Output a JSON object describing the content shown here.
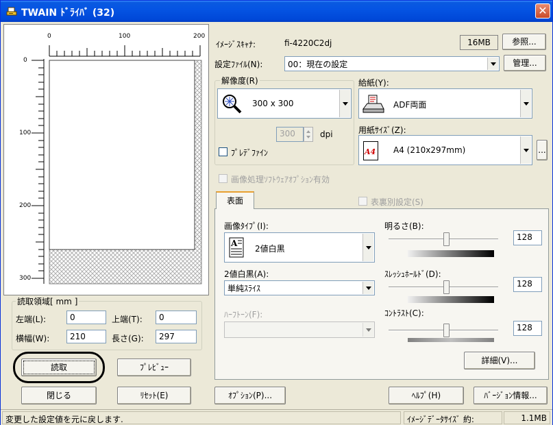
{
  "window": {
    "title": "TWAIN ﾄﾞﾗｲﾊﾞ (32)",
    "close_glyph": "✕"
  },
  "ruler": {
    "top_labels": [
      "0",
      "100",
      "200"
    ],
    "left_labels": [
      "0",
      "100",
      "200",
      "300"
    ]
  },
  "region": {
    "title": "読取領域[ mm ]",
    "left_label": "左端(L):",
    "left_value": "0",
    "top_label": "上端(T):",
    "top_value": "0",
    "width_label": "横幅(W):",
    "width_value": "210",
    "height_label": "長さ(G):",
    "height_value": "297"
  },
  "left_buttons": {
    "scan": "読取",
    "preview": "ﾌﾟﾚﾋﾞｭｰ",
    "close": "閉じる",
    "reset": "ﾘｾｯﾄ(E)"
  },
  "scanner": {
    "label": "ｲﾒｰｼﾞｽｷｬﾅ:",
    "model": "fi-4220C2dj",
    "memory": "16MB",
    "browse_button": "参照..."
  },
  "settings_file": {
    "label": "設定ﾌｧｲﾙ(N):",
    "value": "00：現在の設定",
    "manage_button": "管理..."
  },
  "resolution": {
    "label": "解像度(R)",
    "value": "300 x 300",
    "custom_value": "300",
    "unit": "dpi",
    "predefine_label": "ﾌﾟﾚﾃﾞﾌｧｲﾝ"
  },
  "feed": {
    "label": "給紙(Y):",
    "value": "ADF両面"
  },
  "paper_size": {
    "label": "用紙ｻｲｽﾞ(Z):",
    "value": "A4 (210x297mm)",
    "icon_text": "A4",
    "more_button": "..."
  },
  "image_processing": {
    "label": "画像処理ｿﾌﾄｳｪｱｵﾌﾟｼｮﾝ有効"
  },
  "tab": {
    "label": "表面",
    "duplex_label": "表裏別設定(S)"
  },
  "image_type": {
    "label": "画像ﾀｲﾌﾟ(I):",
    "value": "2値白黒"
  },
  "bw_mode": {
    "label": "2値白黒(A):",
    "value": "単純ｽﾗｲｽ"
  },
  "halftone": {
    "label": "ﾊｰﾌﾄｰﾝ(F):",
    "value": ""
  },
  "brightness": {
    "label": "明るさ(B):",
    "value": "128",
    "level_fraction": 0.5
  },
  "threshold": {
    "label": "ｽﾚｯｼｭﾎｰﾙﾄﾞ(D):",
    "value": "128",
    "level_fraction": 0.5
  },
  "contrast": {
    "label": "ｺﾝﾄﾗｽﾄ(C):",
    "value": "128",
    "level_fraction": 0.5
  },
  "detail_button": "詳細(V)...",
  "bottom_buttons": {
    "option": "ｵﾌﾟｼｮﾝ(P)...",
    "help": "ﾍﾙﾌﾟ(H)",
    "version": "ﾊﾞｰｼﾞｮﾝ情報..."
  },
  "status": {
    "message": "変更した設定値を元に戻します.",
    "size_label": "ｲﾒｰｼﾞﾃﾞｰﾀｻｲｽﾞ 約:",
    "size_value": "1.1MB"
  }
}
